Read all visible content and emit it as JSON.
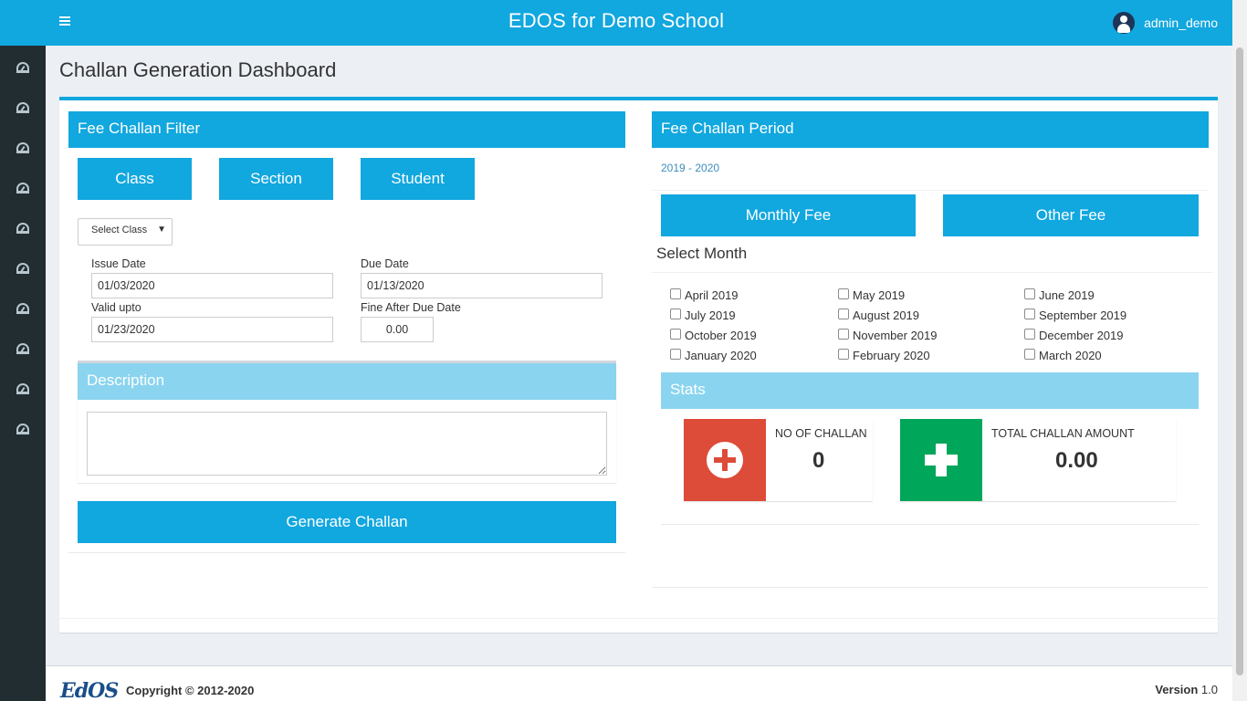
{
  "header": {
    "title": "EDOS for Demo School",
    "username": "admin_demo"
  },
  "sidebar": {
    "icons": [
      "dashboard-icon",
      "dashboard-icon",
      "dashboard-icon",
      "dashboard-icon",
      "dashboard-icon",
      "dashboard-icon",
      "dashboard-icon",
      "dashboard-icon",
      "dashboard-icon",
      "dashboard-icon"
    ]
  },
  "page": {
    "title": "Challan Generation Dashboard"
  },
  "filter": {
    "heading": "Fee Challan Filter",
    "buttons": {
      "class": "Class",
      "section": "Section",
      "student": "Student"
    },
    "select_class": "Select Class",
    "issue_date_label": "Issue Date",
    "issue_date": "01/03/2020",
    "due_date_label": "Due Date",
    "due_date": "01/13/2020",
    "valid_upto_label": "Valid upto",
    "valid_upto": "01/23/2020",
    "fine_label": "Fine After Due Date",
    "fine": "0.00",
    "description_heading": "Description",
    "description": "",
    "generate_button": "Generate Challan"
  },
  "period": {
    "heading": "Fee Challan Period",
    "session": "2019 - 2020",
    "monthly_fee_button": "Monthly Fee",
    "other_fee_button": "Other Fee",
    "select_month_label": "Select Month",
    "months": [
      "April 2019",
      "May 2019",
      "June 2019",
      "July 2019",
      "August 2019",
      "September 2019",
      "October 2019",
      "November 2019",
      "December 2019",
      "January 2020",
      "February 2020",
      "March 2020"
    ]
  },
  "stats": {
    "heading": "Stats",
    "challan_count_label": "NO OF CHALLAN",
    "challan_count": "0",
    "challan_amount_label": "TOTAL CHALLAN AMOUNT",
    "challan_amount": "0.00",
    "colors": {
      "count": "#dd4b39",
      "amount": "#00a65a"
    }
  },
  "footer": {
    "logo": "EdOS",
    "copyright": "Copyright © 2012-2020",
    "version_label": "Version",
    "version": "1.0"
  },
  "theme": {
    "primary": "#11a7df",
    "light": "#8ad4ef",
    "sidebar": "#222d32"
  }
}
